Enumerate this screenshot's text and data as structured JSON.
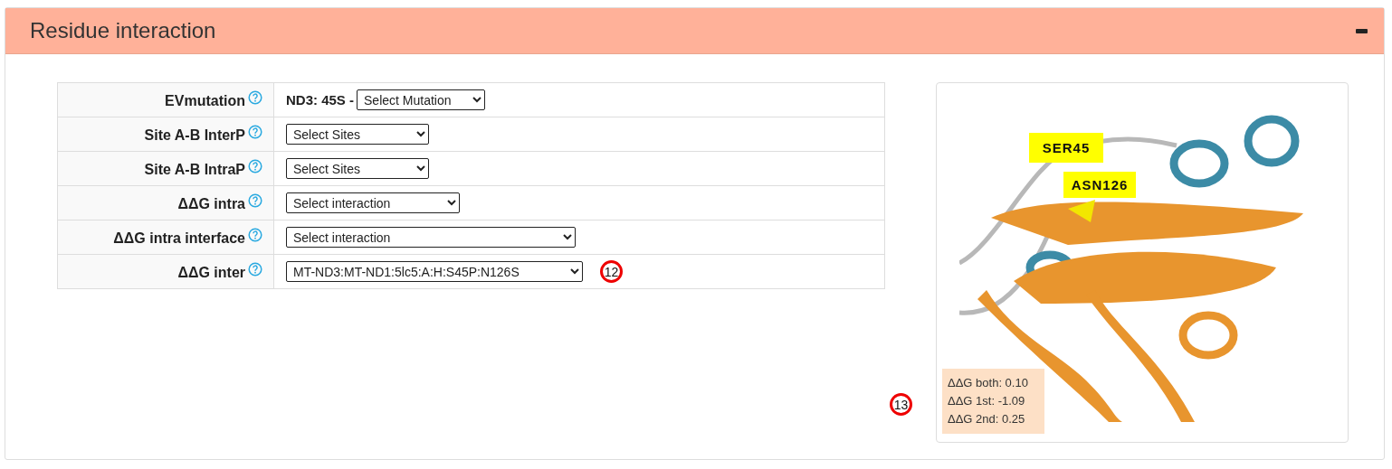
{
  "panel": {
    "title": "Residue interaction",
    "collapsed": false
  },
  "rows": [
    {
      "label": "EVmutation",
      "prefix": "ND3: 45S -",
      "select": "Select Mutation"
    },
    {
      "label": "Site A-B InterP",
      "select": "Select Sites"
    },
    {
      "label": "Site A-B IntraP",
      "select": "Select Sites"
    },
    {
      "label": "ΔΔG intra",
      "select": "Select interaction"
    },
    {
      "label": "ΔΔG intra interface",
      "select": "Select interaction"
    },
    {
      "label": "ΔΔG inter",
      "select": "MT-ND3:MT-ND1:5lc5:A:H:S45P:N126S",
      "marker": "12"
    }
  ],
  "viewer": {
    "kind": "picture",
    "labels": [
      "SER45",
      "ASN126"
    ],
    "stats": [
      "ΔΔG both: 0.10",
      "ΔΔG 1st: -1.09",
      "ΔΔG 2nd: 0.25"
    ],
    "marker": "13"
  }
}
